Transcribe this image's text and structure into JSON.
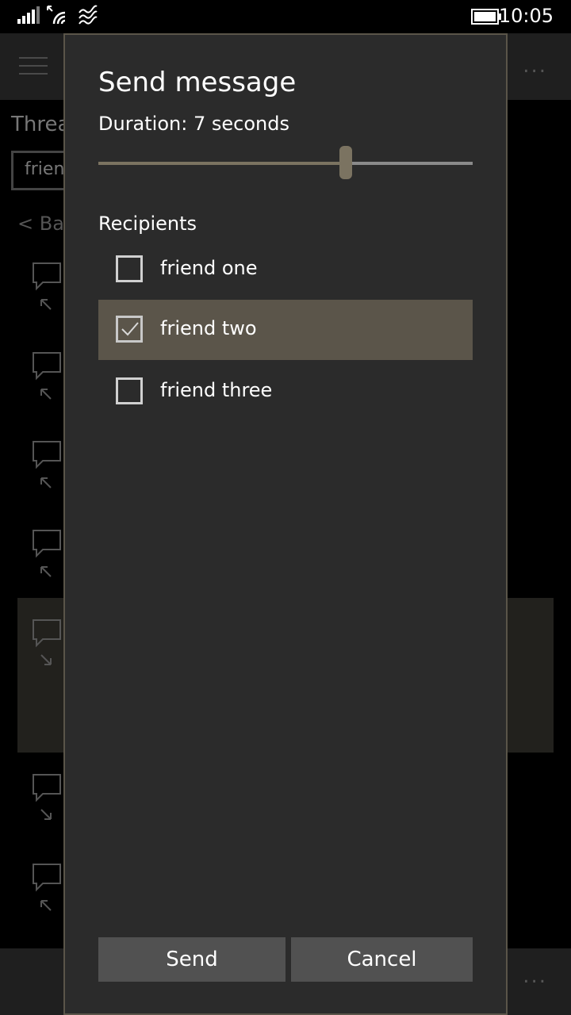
{
  "status_bar": {
    "time": "10:05",
    "icons": [
      "signal-icon",
      "wifi-icon",
      "vibrate-icon",
      "battery-icon"
    ]
  },
  "background": {
    "title_fragment": "Threa",
    "input_fragment": "frien",
    "back_fragment": "< Bac",
    "more": "..."
  },
  "dialog": {
    "title": "Send message",
    "duration_label": "Duration: 7 seconds",
    "duration_fraction": 0.66,
    "recipients_label": "Recipients",
    "recipients": [
      {
        "name": "friend one",
        "checked": false
      },
      {
        "name": "friend two",
        "checked": true
      },
      {
        "name": "friend three",
        "checked": false
      }
    ],
    "send_label": "Send",
    "cancel_label": "Cancel"
  },
  "colors": {
    "accent": "#7b7361",
    "selected_row": "#5b554a",
    "dialog_bg": "#2b2b2b",
    "button_bg": "#515151"
  }
}
